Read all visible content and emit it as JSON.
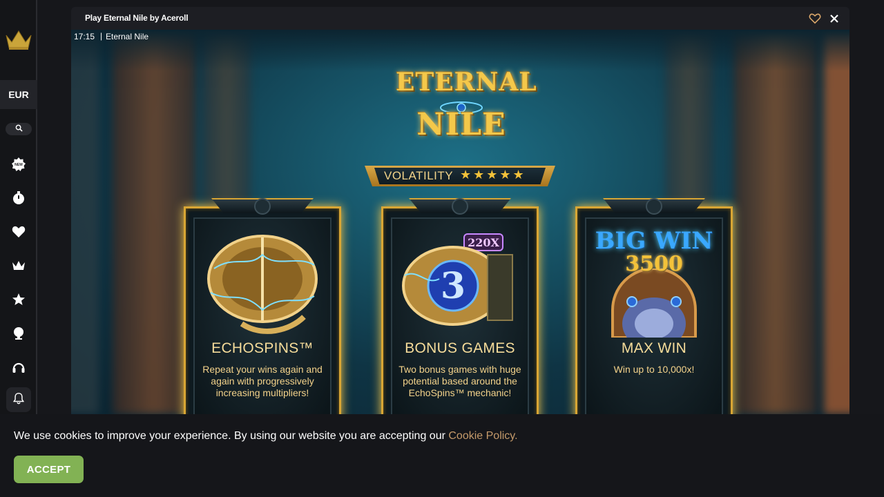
{
  "sidebar": {
    "currency": "EUR",
    "icons": [
      "crown-logo-icon",
      "search-icon",
      "new-badge-icon",
      "timer-icon",
      "heart-icon",
      "crown-icon",
      "star-icon",
      "trophy-icon",
      "headset-icon",
      "bell-icon"
    ],
    "new_badge": "NEW"
  },
  "window": {
    "title": "Play Eternal Nile by Aceroll"
  },
  "game": {
    "time": "17:15",
    "separator": "|",
    "name": "Eternal Nile",
    "logo_line1": "ETERNAL",
    "logo_line2": "NILE",
    "volatility_label": "VOLATILITY",
    "volatility_rating": 5,
    "volatility_stars": "★★★★★",
    "cards": [
      {
        "title": "ECHOSPINS™",
        "text": "Repeat your wins again and again with progressively increasing multipliers!"
      },
      {
        "title": "BONUS GAMES",
        "text": "Two bonus games with huge potential based around the EchoSpins™ mechanic!",
        "art_multiplier": "220X",
        "art_number": "3"
      },
      {
        "title": "MAX WIN",
        "text": "Win up to 10,000x!",
        "art_line1": "BIG WIN",
        "art_line2": "3500"
      }
    ]
  },
  "cookie": {
    "text": "We use cookies to improve your experience. By using our website you are accepting our ",
    "link": "Cookie Policy.",
    "accept_label": "ACCEPT"
  },
  "colors": {
    "accent_gold": "#d9a634",
    "accept_green": "#82b254",
    "link_color": "#c59a6a"
  }
}
